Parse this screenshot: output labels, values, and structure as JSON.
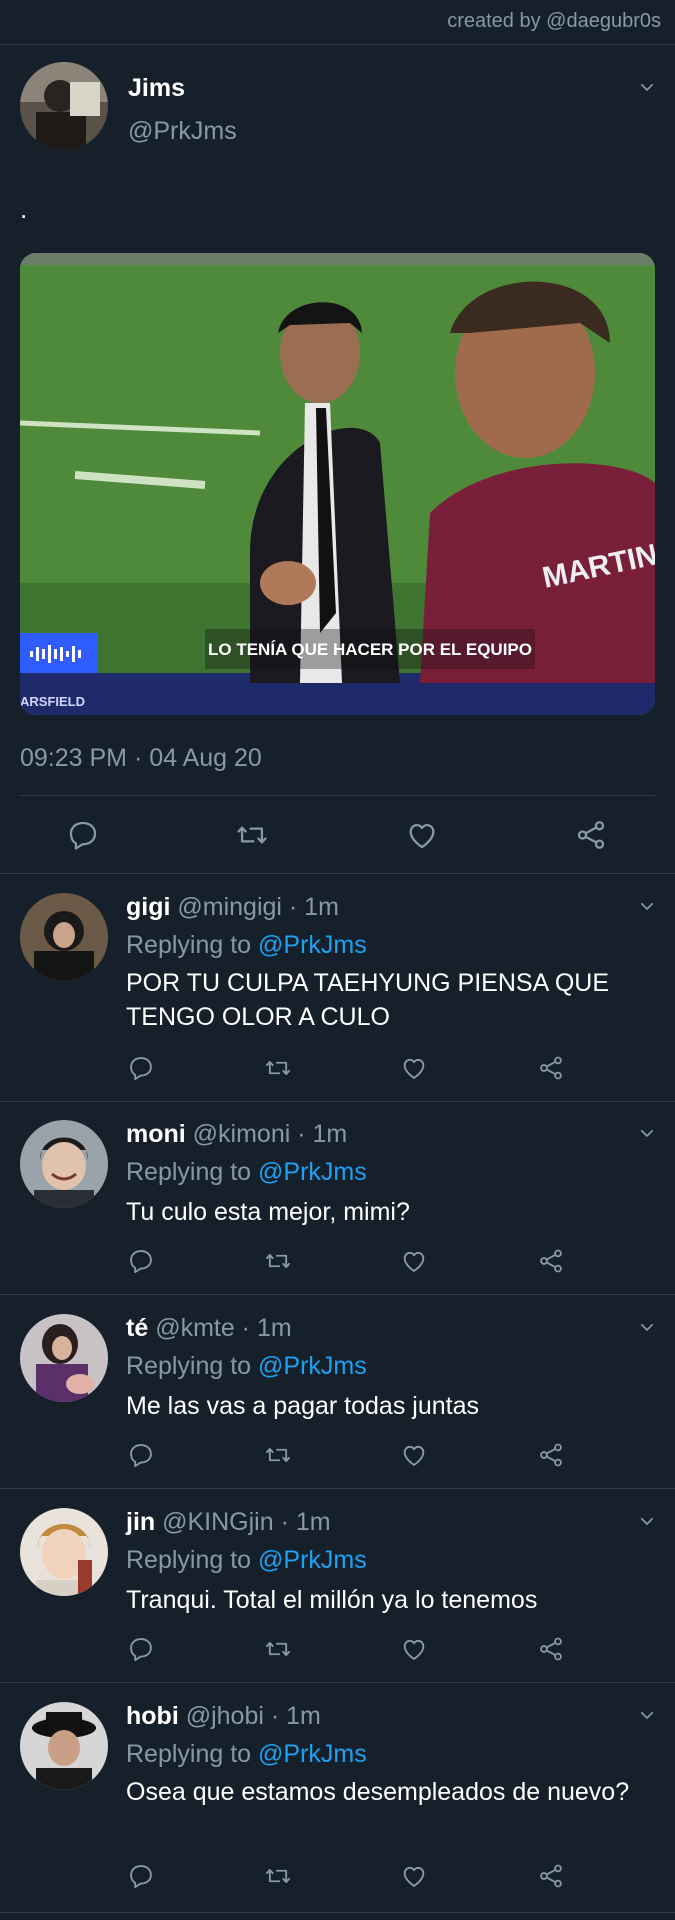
{
  "credit": "created by @daegubr0s",
  "main_tweet": {
    "name": "Jims",
    "handle": "@PrkJms",
    "text": ".",
    "media": {
      "caption": "LO TENÍA QUE HACER POR EL EQUIPO",
      "broadcast_tag": "ARSFIELD",
      "jersey_text": "MARTINEZ"
    },
    "timestamp": "09:23 PM · 04 Aug 20"
  },
  "replies": [
    {
      "name": "gigi",
      "handle": "@mingigi · 1m",
      "replying_prefix": "Replying to ",
      "replying_to": "@PrkJms",
      "text": "POR TU CULPA TAEHYUNG PIENSA QUE TENGO OLOR A CULO"
    },
    {
      "name": "moni",
      "handle": "@kimoni · 1m",
      "replying_prefix": "Replying to ",
      "replying_to": "@PrkJms",
      "text": "Tu culo esta mejor, mimi?"
    },
    {
      "name": "té",
      "handle": "@kmte · 1m",
      "replying_prefix": "Replying to ",
      "replying_to": "@PrkJms",
      "text": "Me las vas a pagar todas juntas"
    },
    {
      "name": "jin",
      "handle": "@KINGjin · 1m",
      "replying_prefix": "Replying to ",
      "replying_to": "@PrkJms",
      "text": "Tranqui. Total el millón ya lo tenemos"
    },
    {
      "name": "hobi",
      "handle": "@jhobi · 1m",
      "replying_prefix": "Replying to ",
      "replying_to": "@PrkJms",
      "text": "Osea que estamos desempleados de nuevo?"
    }
  ],
  "colors": {
    "background": "#15202b",
    "secondary_text": "#8899a6",
    "link": "#1da1f2",
    "divider": "#2f3b47"
  },
  "icons": [
    "chevron-down-icon",
    "reply-icon",
    "retweet-icon",
    "like-icon",
    "share-icon"
  ]
}
